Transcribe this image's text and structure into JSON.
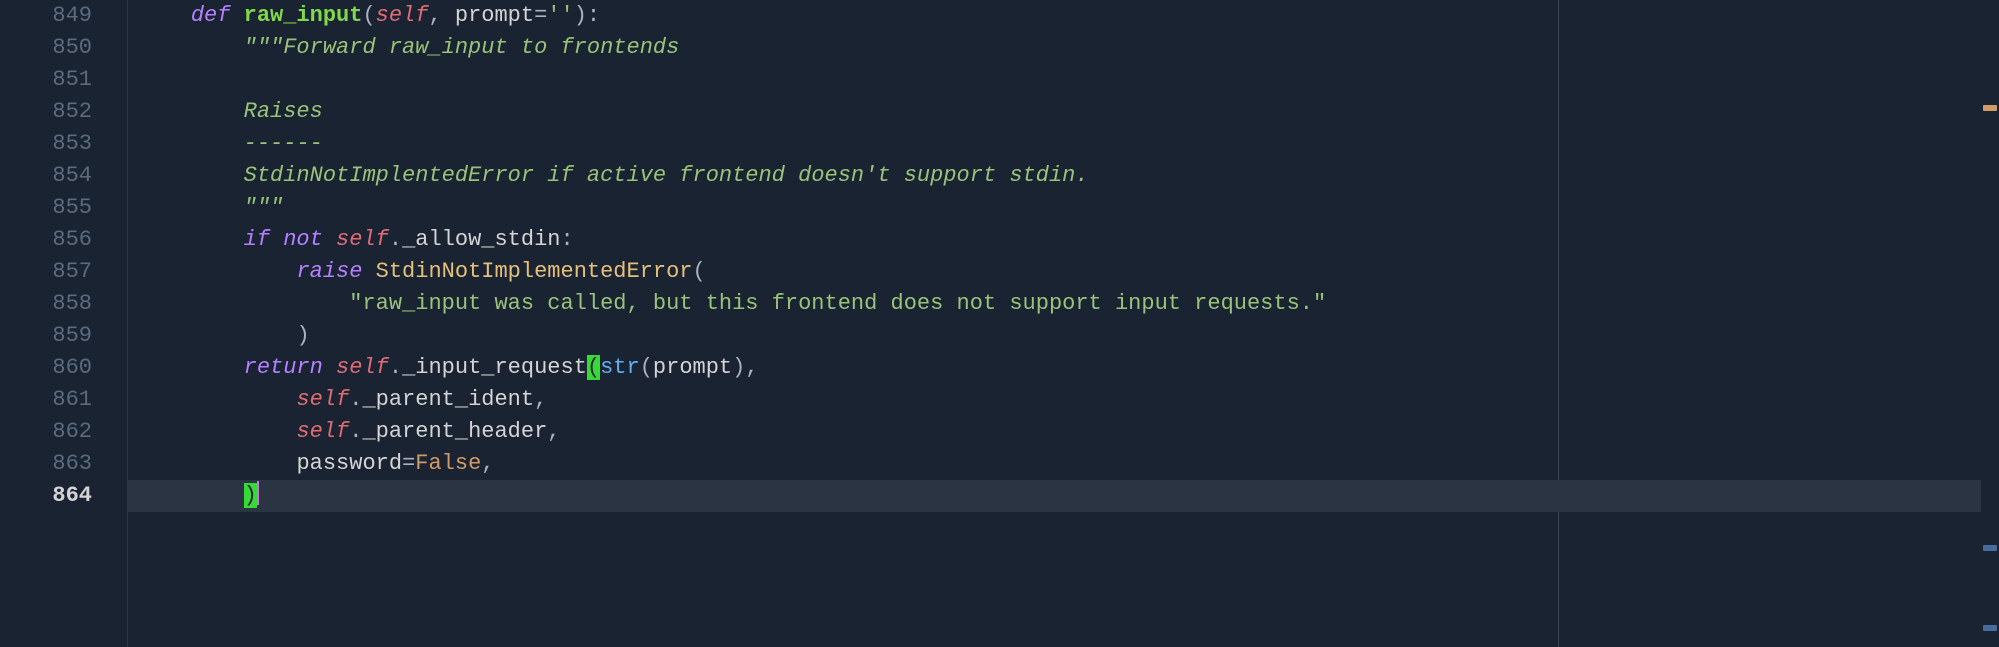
{
  "gutter": {
    "start": 849,
    "lines": [
      "849",
      "850",
      "851",
      "852",
      "853",
      "854",
      "855",
      "856",
      "857",
      "858",
      "859",
      "860",
      "861",
      "862",
      "863",
      "864"
    ],
    "active_line": "864"
  },
  "code": {
    "l849": {
      "indent": "    ",
      "def": "def ",
      "fn": "raw_input",
      "open": "(",
      "self": "self",
      "sep": ", ",
      "param": "prompt",
      "eq": "=",
      "val": "''",
      "close": "):"
    },
    "l850": {
      "indent": "        ",
      "doc": "\"\"\"Forward raw_input to frontends"
    },
    "l851": {
      "indent": "",
      "text": ""
    },
    "l852": {
      "indent": "        ",
      "doc": "Raises"
    },
    "l853": {
      "indent": "        ",
      "doc": "------"
    },
    "l854": {
      "indent": "        ",
      "doc": "StdinNotImplentedError if active frontend doesn't support stdin."
    },
    "l855": {
      "indent": "        ",
      "doc": "\"\"\""
    },
    "l856": {
      "indent": "        ",
      "if": "if ",
      "not": "not ",
      "self": "self",
      "dot": ".",
      "attr": "_allow_stdin",
      "colon": ":"
    },
    "l857": {
      "indent": "            ",
      "raise": "raise ",
      "class": "StdinNotImplementedError",
      "open": "("
    },
    "l858": {
      "indent": "                ",
      "str": "\"raw_input was called, but this frontend does not support input requests.\""
    },
    "l859": {
      "indent": "            ",
      "close": ")"
    },
    "l860": {
      "indent": "        ",
      "return": "return ",
      "self": "self",
      "dot": ".",
      "attr": "_input_request",
      "open": "(",
      "builtin": "str",
      "open2": "(",
      "arg": "prompt",
      "close2": ")",
      "comma": ","
    },
    "l861": {
      "indent": "            ",
      "self": "self",
      "dot": ".",
      "attr": "_parent_ident",
      "comma": ","
    },
    "l862": {
      "indent": "            ",
      "self": "self",
      "dot": ".",
      "attr": "_parent_header",
      "comma": ","
    },
    "l863": {
      "indent": "            ",
      "param": "password",
      "eq": "=",
      "const": "False",
      "comma": ","
    },
    "l864": {
      "indent": "        ",
      "close": ")"
    }
  }
}
